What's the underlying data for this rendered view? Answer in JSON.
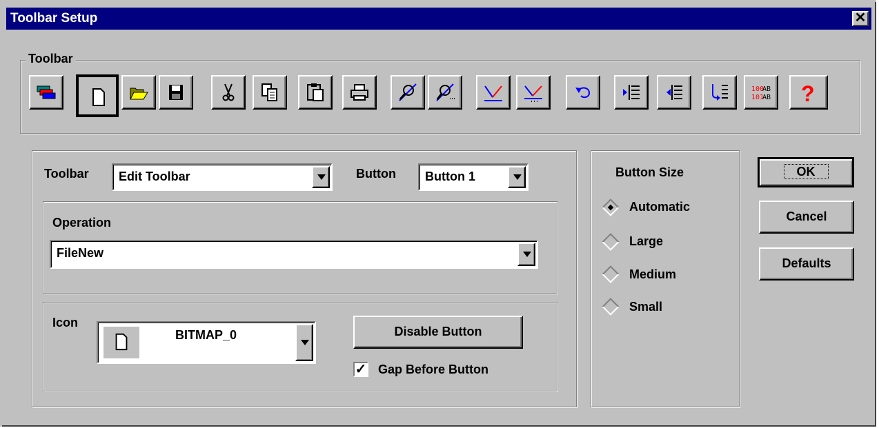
{
  "window": {
    "title": "Toolbar Setup",
    "close_glyph": "✕"
  },
  "toolbar_group": {
    "label": "Toolbar",
    "buttons": [
      {
        "icon": "edit-toolbar-icon"
      },
      {
        "icon": "file-new-icon"
      },
      {
        "icon": "file-open-icon"
      },
      {
        "icon": "file-save-icon"
      },
      {
        "icon": "cut-icon"
      },
      {
        "icon": "copy-icon"
      },
      {
        "icon": "paste-icon"
      },
      {
        "icon": "print-icon"
      },
      {
        "icon": "zoom-icon"
      },
      {
        "icon": "zoom-more-icon"
      },
      {
        "icon": "connect-icon"
      },
      {
        "icon": "connect-more-icon"
      },
      {
        "icon": "undo-icon"
      },
      {
        "icon": "indent-icon"
      },
      {
        "icon": "outdent-icon"
      },
      {
        "icon": "branch-list-icon"
      },
      {
        "icon": "hex-ascii-icon"
      },
      {
        "icon": "help-icon"
      }
    ]
  },
  "settings": {
    "toolbar_label": "Toolbar",
    "toolbar_value": "Edit Toolbar",
    "button_label": "Button",
    "button_value": "Button 1",
    "operation_label": "Operation",
    "operation_value": "FileNew",
    "icon_label": "Icon",
    "icon_value": "BITMAP_0",
    "disable_button": "Disable Button",
    "gap_checkbox_label": "Gap Before Button",
    "gap_checked": true
  },
  "button_size": {
    "label": "Button Size",
    "options": [
      "Automatic",
      "Large",
      "Medium",
      "Small"
    ],
    "selected": "Automatic"
  },
  "actions": {
    "ok": "OK",
    "cancel": "Cancel",
    "defaults": "Defaults"
  },
  "colors": {
    "title_bar": "#000080",
    "face": "#c0c0c0",
    "help_red": "#ff0000"
  }
}
